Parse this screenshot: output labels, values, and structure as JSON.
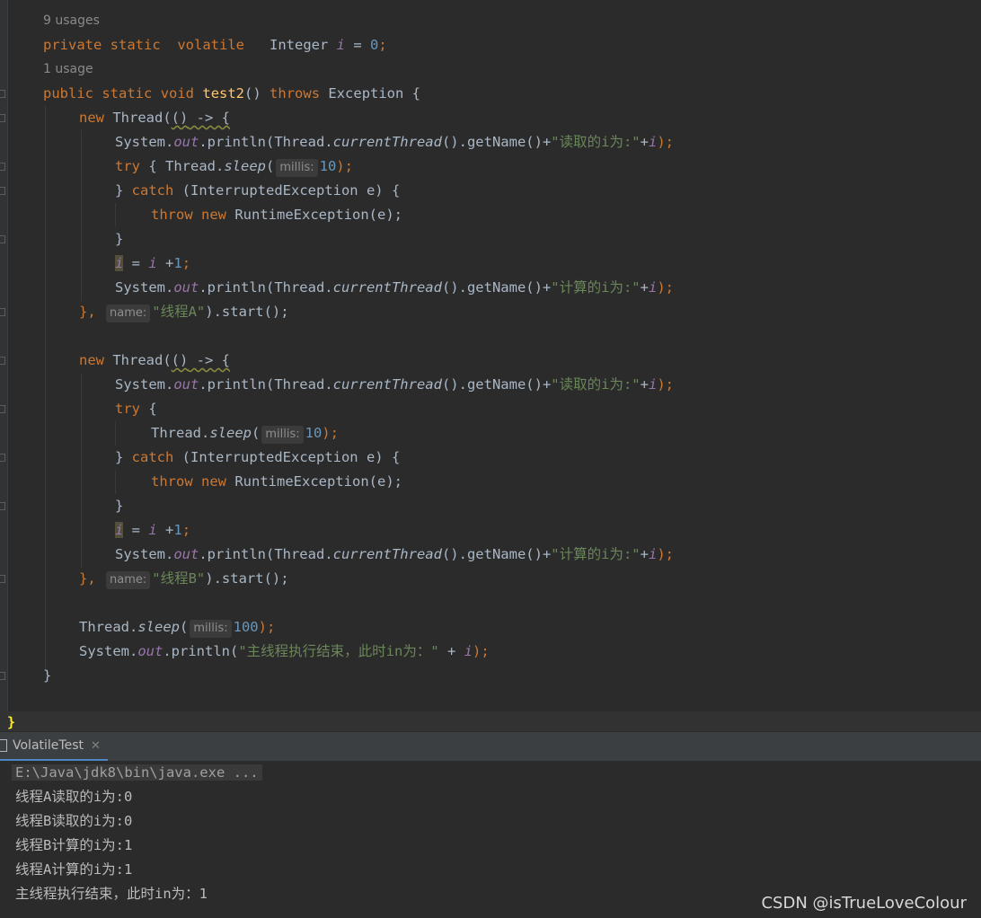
{
  "code": {
    "usages_field": "9 usages",
    "field_decl": {
      "private": "private",
      "static": "static",
      "volatile": "volatile",
      "type": "Integer",
      "name": "i",
      "eq": " = ",
      "init": "0",
      "semi": ";"
    },
    "usages_method": "1 usage",
    "method_decl": {
      "public": "public",
      "static": "static",
      "void": "void",
      "name": "test2",
      "parens": "() ",
      "throws": "throws",
      "rest": " Exception {"
    },
    "kw_new": "new",
    "thread_open": " Thread(",
    "lambda_parens": "()",
    "lambda_arrow": " -> {",
    "sys": "System.",
    "out": "out",
    "println": ".println(Thread.",
    "current_thread": "currentThread",
    "get_name": "().getName()+",
    "str_read": "\"读取的i为:\"",
    "str_calc": "\"计算的i为:\"",
    "plus": "+",
    "var_i": "i",
    "close_paren_semi": ");",
    "kw_try": "try",
    "try_inline_open": " { Thread.",
    "try_block_open": " {",
    "thread_prefix": "Thread.",
    "sleep": "sleep",
    "open_paren": "(",
    "hint_millis": "millis:",
    "sleep_10": "10",
    "sleep_100": "100",
    "catch_close": "} ",
    "kw_catch": "catch",
    "catch_rest": " (InterruptedException e) {",
    "kw_throw": "throw",
    "runtime": " RuntimeException(e);",
    "close_brace": "}",
    "assign_eq": " = ",
    "assign_plus": " +",
    "one": "1",
    "semi": ";",
    "lambda_close": "},",
    "hint_name": "name:",
    "str_thread_a": "\"线程A\"",
    "str_thread_b": "\"线程B\"",
    "start": ").start();",
    "print_main_open": ".println(",
    "str_main": "\"主线程执行结束，此时in为：\"",
    "plus_sp": " + ",
    "method_close": "}",
    "class_close": "}"
  },
  "run_panel": {
    "tab_label": "VolatileTest",
    "close_symbol": "✕",
    "output": [
      "E:\\Java\\jdk8\\bin\\java.exe ...",
      "线程A读取的i为:0",
      "线程B读取的i为:0",
      "线程B计算的i为:1",
      "线程A计算的i为:1",
      "主线程执行结束，此时in为：1"
    ]
  },
  "watermark": "CSDN @isTrueLoveColour",
  "colors": {
    "keyword": "#cc7832",
    "method": "#ffc66d",
    "number": "#6897bb",
    "string": "#6a8759",
    "field": "#9876aa",
    "text": "#a9b7c6",
    "background": "#2b2b2b"
  },
  "icons": {
    "run_tab": "console-icon",
    "close": "close-icon"
  }
}
